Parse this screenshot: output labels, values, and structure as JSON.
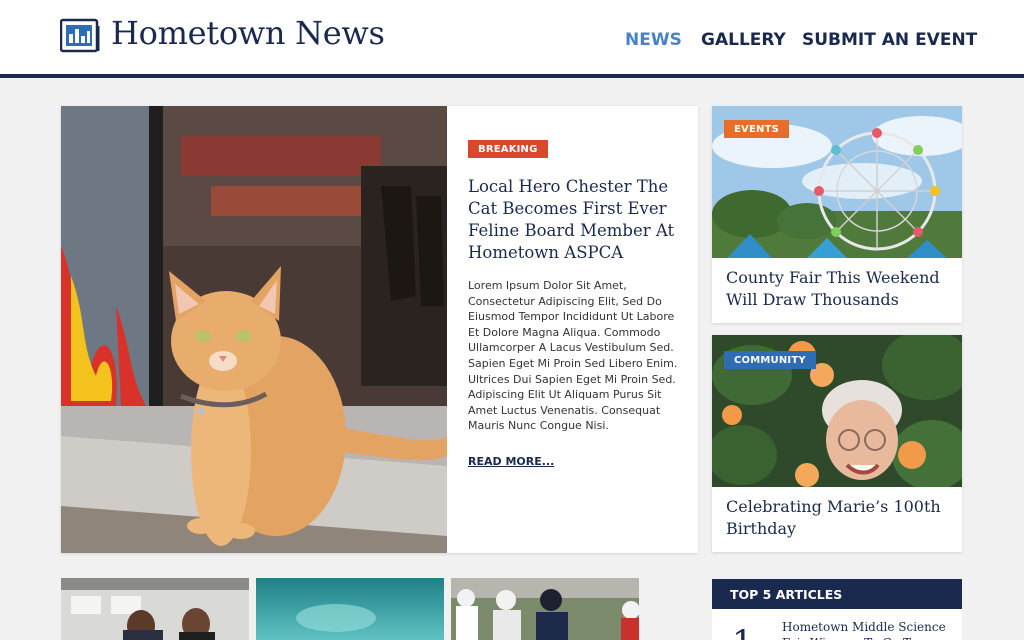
{
  "header": {
    "site_title": "Hometown News",
    "logo_icon": "newspaper-icon",
    "nav": [
      {
        "label": "NEWS",
        "active": true
      },
      {
        "label": "GALLERY",
        "active": false
      },
      {
        "label": "SUBMIT AN EVENT",
        "active": false
      }
    ]
  },
  "feature": {
    "tag": "BREAKING",
    "title": "Local Hero Chester The Cat Becomes First Ever Feline Board Member At Hometown ASPCA",
    "excerpt": "Lorem Ipsum Dolor Sit Amet, Consectetur Adipiscing Elit, Sed Do Eiusmod Tempor Incididunt Ut Labore Et Dolore Magna Aliqua. Commodo Ullamcorper A Lacus Vestibulum Sed. Sapien Eget Mi Proin Sed Libero Enim. Ultrices Dui Sapien Eget Mi Proin Sed. Adipiscing Elit Ut Aliquam Purus Sit Amet Luctus Venenatis. Consequat Mauris Nunc Congue Nisi.",
    "read_more": "READ MORE..."
  },
  "side_cards": [
    {
      "tag": "EVENTS",
      "title": "County Fair This Weekend Will Draw Thousands"
    },
    {
      "tag": "COMMUNITY",
      "title": "Celebrating Marie’s 100th Birthday"
    }
  ],
  "top5": {
    "heading": "TOP 5 ARTICLES",
    "items": [
      {
        "rank": "1",
        "title": "Hometown Middle Science Fair Winners To Go To State"
      }
    ]
  },
  "colors": {
    "navy": "#1a2a4e",
    "nav_active": "#4a82c9",
    "breaking": "#d9482b",
    "events": "#e96d2a",
    "community": "#2e6db4"
  }
}
